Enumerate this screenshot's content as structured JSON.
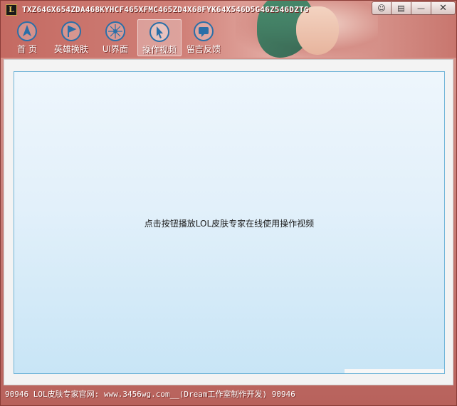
{
  "window": {
    "title": "TXZ64GX654ZDA468KYHCF465XFMC465ZD4X68FYK64X546D5G46Z546DZTG",
    "logo_text": "L",
    "controls": {
      "skin": "☺",
      "menu": "▤",
      "minimize": "—",
      "close": "✕"
    }
  },
  "nav": {
    "items": [
      {
        "label": "首 页",
        "icon": "arrow-up-icon"
      },
      {
        "label": "英雄换肤",
        "icon": "flag-icon"
      },
      {
        "label": "UI界面",
        "icon": "compass-icon"
      },
      {
        "label": "操作视频",
        "icon": "cursor-icon",
        "active": true
      },
      {
        "label": "留言反馈",
        "icon": "message-icon"
      }
    ]
  },
  "main": {
    "message": "点击按钮播放LOL皮肤专家在线使用操作视频"
  },
  "status": {
    "text": "90946  LOL皮肤专家官网: www.3456wg.com__(Dream工作室制作开发) 90946"
  },
  "colors": {
    "accent": "#c46a62",
    "panel_border": "#6fb4d8",
    "panel_bg": "#e2f0fa"
  }
}
